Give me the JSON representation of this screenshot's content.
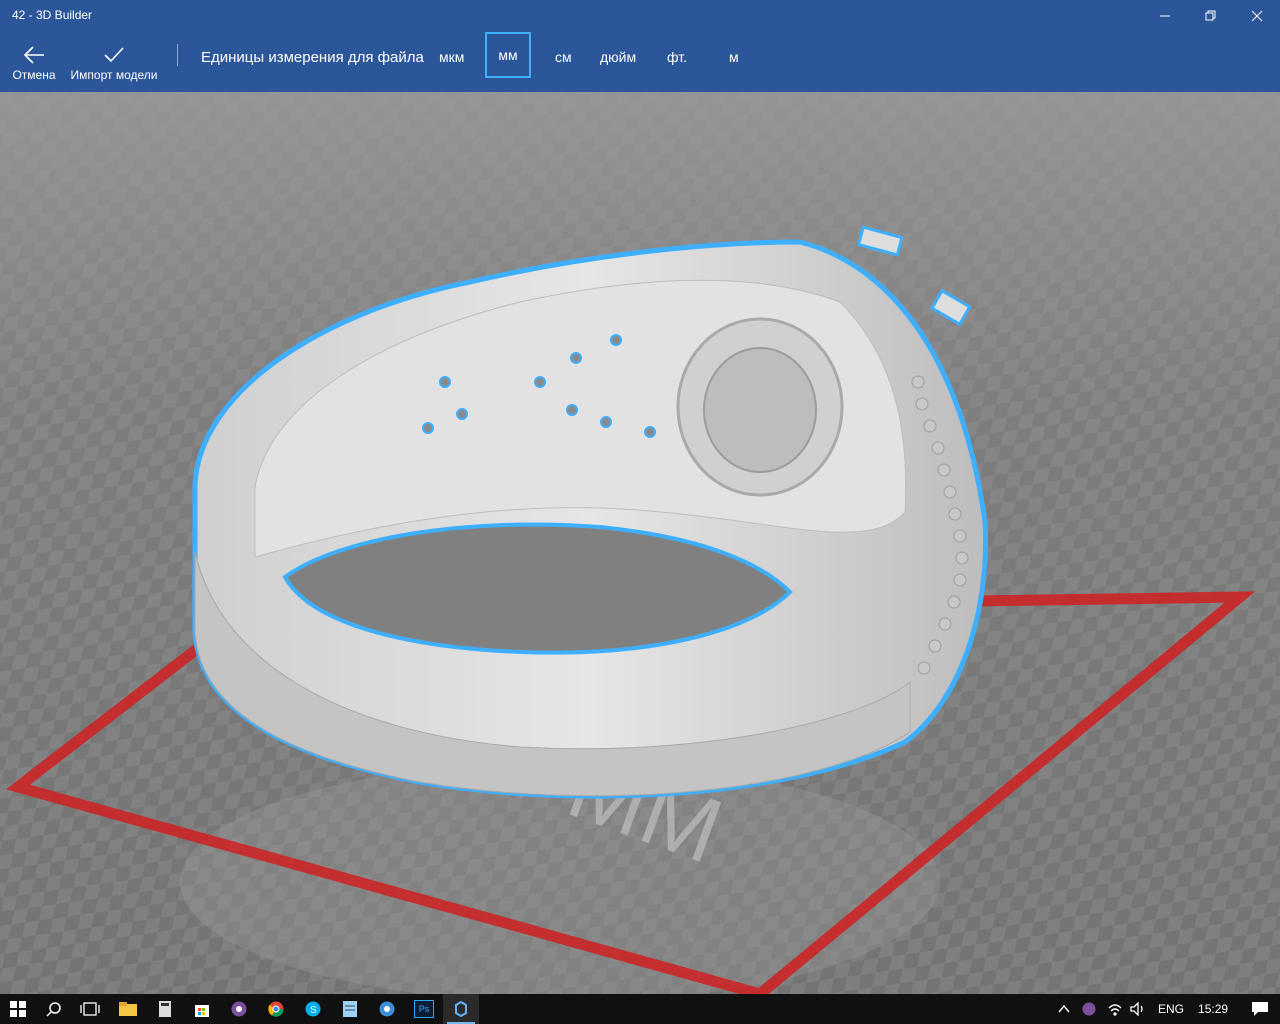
{
  "window": {
    "title": "42 - 3D Builder",
    "minimize_icon": "minimize-icon",
    "maximize_icon": "restore-icon",
    "close_icon": "close-icon"
  },
  "toolbar": {
    "cancel_label": "Отмена",
    "import_label": "Импорт модели",
    "units_label": "Единицы измерения для файла",
    "units": [
      "мкм",
      "мм",
      "см",
      "дюйм",
      "фт.",
      "м"
    ],
    "selected_unit": "мм",
    "accent": "#2b579a",
    "selection_outline": "#3fb0ff"
  },
  "viewport": {
    "floor_text": "0 MM",
    "bounding_color": "#d02020",
    "selection_color": "#3fb0ff",
    "model_color": "#d9d9d9"
  },
  "taskbar": {
    "apps": [
      "start-icon",
      "search-icon",
      "task-view-icon",
      "file-explorer-icon",
      "calculator-icon",
      "store-icon",
      "viber-icon",
      "chrome-icon",
      "skype-icon",
      "notepad-icon",
      "browser-icon",
      "photoshop-icon",
      "3d-builder-icon"
    ],
    "photoshop_text": "Ps",
    "language": "ENG",
    "time": "15:29"
  }
}
